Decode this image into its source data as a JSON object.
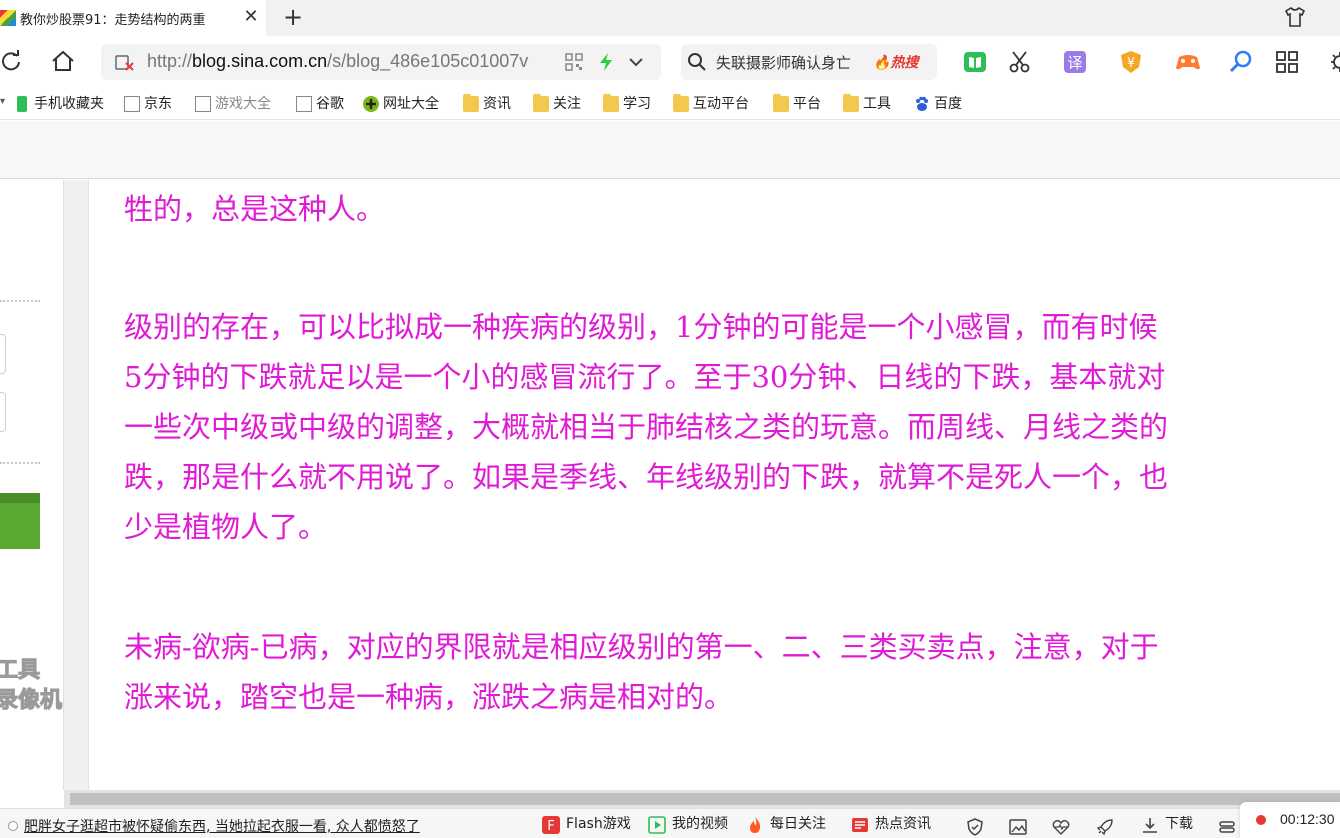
{
  "tab": {
    "title": "教你炒股票91：走势结构的两重",
    "close_label": "✕",
    "new_tab_label": "+"
  },
  "address_bar": {
    "url_prefix": "http://",
    "url_domain": "blog.sina.com.cn",
    "url_path": "/s/blog_486e105c01007v"
  },
  "search": {
    "placeholder_query": "失联摄影师确认身亡",
    "hot_badge": "热搜"
  },
  "toolbar_icons": [
    "reading-icon",
    "scissors-icon",
    "translate-icon",
    "coupon-icon",
    "game-icon",
    "magnifier-icon",
    "apps-grid-icon",
    "settings-icon"
  ],
  "bookmarks": [
    {
      "label": "手机收藏夹",
      "icon": "phone-icon"
    },
    {
      "label": "京东",
      "icon": "page-icon"
    },
    {
      "label": "游戏大全",
      "icon": "page-icon"
    },
    {
      "label": "谷歌",
      "icon": "page-icon"
    },
    {
      "label": "网址大全",
      "icon": "plus-circle-icon"
    },
    {
      "label": "资讯",
      "icon": "folder-icon"
    },
    {
      "label": "关注",
      "icon": "folder-icon"
    },
    {
      "label": "学习",
      "icon": "folder-icon"
    },
    {
      "label": "互动平台",
      "icon": "folder-icon"
    },
    {
      "label": "平台",
      "icon": "folder-icon"
    },
    {
      "label": "工具",
      "icon": "folder-icon"
    },
    {
      "label": "百度",
      "icon": "baidu-paw-icon"
    }
  ],
  "sidebar": {
    "logo_text": "工具\n录像机"
  },
  "article": {
    "paragraphs": [
      {
        "lines": [
          "牲的，总是这种人。"
        ]
      },
      {
        "lines": [
          "级别的存在，可以比拟成一种疾病的级别，1分钟的可能是一个小感冒，而有时候",
          "5分钟的下跌就足以是一个小的感冒流行了。至于30分钟、日线的下跌，基本就对",
          "一些次中级或中级的调整，大概就相当于肺结核之类的玩意。而周线、月线之类的",
          "跌，那是什么就不用说了。如果是季线、年线级别的下跌，就算不是死人一个，也",
          "少是植物人了。"
        ]
      },
      {
        "lines": [
          "未病-欲病-已病，对应的界限就是相应级别的第一、二、三类买卖点，注意，对于",
          "涨来说，踏空也是一种病，涨跌之病是相对的。"
        ]
      }
    ],
    "text_color": "#e01bd5"
  },
  "statusbar": {
    "news": "肥胖女子逛超市被怀疑偷东西, 当她拉起衣服一看, 众人都愤怒了",
    "items": [
      {
        "label": "Flash游戏",
        "icon": "flash-icon"
      },
      {
        "label": "我的视频",
        "icon": "video-icon"
      },
      {
        "label": "每日关注",
        "icon": "flame-icon"
      },
      {
        "label": "热点资讯",
        "icon": "news-icon"
      }
    ],
    "download_label": "下载",
    "timer": "00:12:30"
  }
}
